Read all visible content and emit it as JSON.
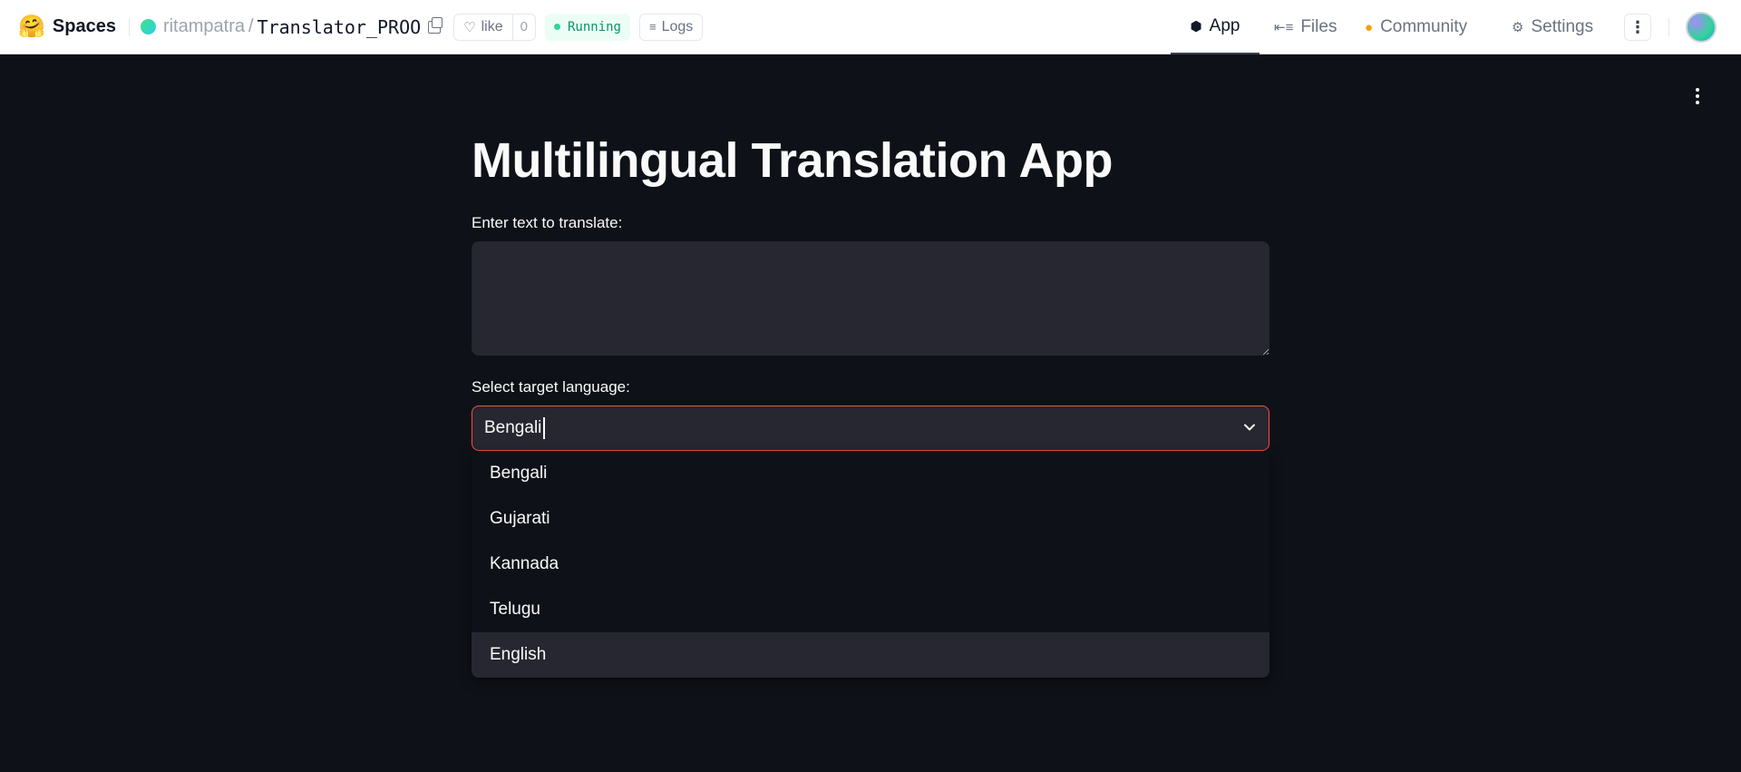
{
  "header": {
    "logo_glyph": "🤗",
    "spaces_label": "Spaces",
    "owner": "ritampatra",
    "separator": "/",
    "repo": "Translator_PROO",
    "like_label": "like",
    "like_count": "0",
    "status": "Running",
    "logs_label": "Logs",
    "nav": {
      "app": "App",
      "files": "Files",
      "community": "Community",
      "settings": "Settings"
    },
    "more_glyph": "⋮"
  },
  "app": {
    "title": "Multilingual Translation App",
    "text_label": "Enter text to translate:",
    "text_value": "",
    "language_label": "Select target language:",
    "language_value": "Bengali",
    "options": [
      "Bengali",
      "Gujarati",
      "Kannada",
      "Telugu",
      "English"
    ],
    "highlighted_option": "English"
  },
  "colors": {
    "background": "#0e1117",
    "input_bg": "#262730",
    "focus_border": "#ff4b4b",
    "status_green": "#059669"
  }
}
